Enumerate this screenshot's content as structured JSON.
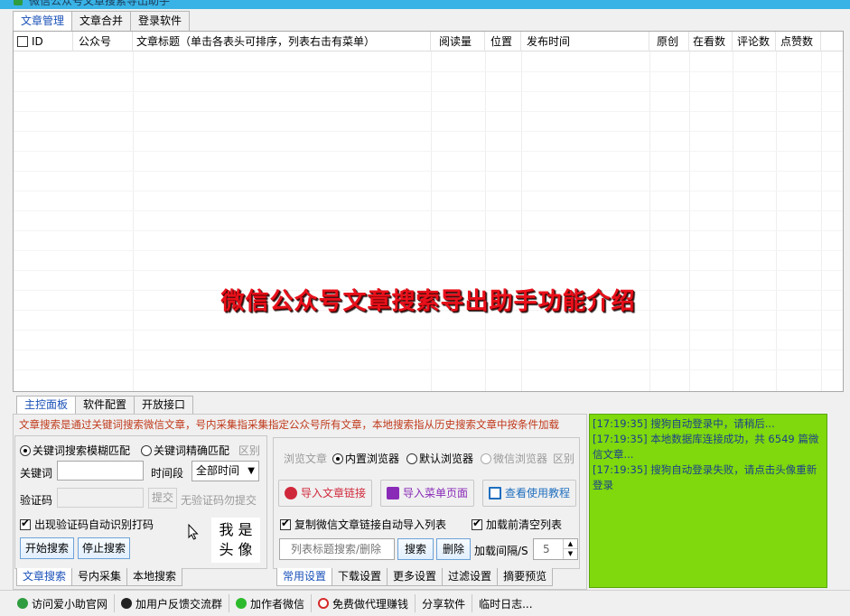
{
  "window": {
    "title": "微信公众号文章搜索导出助手"
  },
  "top_tabs": [
    "文章管理",
    "文章合并",
    "登录软件"
  ],
  "grid": {
    "columns": [
      "ID",
      "公众号",
      "文章标题（单击各表头可排序，列表右击有菜单）",
      "阅读量",
      "位置",
      "发布时间",
      "原创",
      "在看数",
      "评论数",
      "点赞数"
    ],
    "banner": "微信公众号文章搜索导出助手功能介绍"
  },
  "mid_tabs": [
    "主控面板",
    "软件配置",
    "开放接口"
  ],
  "notice": "文章搜索是通过关键词搜索微信文章，号内采集指采集指定公众号所有文章，本地搜索指从历史搜索文章中按条件加载",
  "search_panel": {
    "fuzzy_label": "关键词搜索模糊匹配",
    "exact_label": "关键词精确匹配",
    "distinguish_label": "区别",
    "keyword_label": "关键词",
    "keyword_value": "",
    "time_label": "时间段",
    "time_value": "全部时间",
    "captcha_label": "验证码",
    "captcha_value": "",
    "submit_label": "提交",
    "no_captcha_label": "无验证码勿提交",
    "auto_captcha_label": "出现验证码自动识别打码",
    "start_label": "开始搜索",
    "stop_label": "停止搜索",
    "avatar_line1": "我 是",
    "avatar_line2": "头 像"
  },
  "left_bottom_tabs": [
    "文章搜索",
    "号内采集",
    "本地搜索"
  ],
  "browse_panel": {
    "browse_label": "浏览文章",
    "builtin_label": "内置浏览器",
    "default_label": "默认浏览器",
    "wechat_label": "微信浏览器",
    "distinguish_label": "区别",
    "import_link_label": "导入文章链接",
    "import_menu_label": "导入菜单页面",
    "tutorial_label": "查看使用教程",
    "copy_link_label": "复制微信文章链接自动导入列表",
    "clear_before_label": "加载前清空列表",
    "filter_placeholder": "列表标题搜索/删除",
    "search_label": "搜索",
    "delete_label": "删除",
    "interval_label": "加载间隔/S",
    "interval_value": "5"
  },
  "right_bottom_tabs": [
    "常用设置",
    "下载设置",
    "更多设置",
    "过滤设置",
    "摘要预览"
  ],
  "log_lines": [
    "[17:19:35] 搜狗自动登录中，请稍后...",
    "[17:19:35] 本地数据库连接成功，共 6549 篇微信文章...",
    "[17:19:35] 搜狗自动登录失败，请点击头像重新登录"
  ],
  "statusbar": [
    "访问爱小助官网",
    "加用户反馈交流群",
    "加作者微信",
    "免费做代理赚钱",
    "分享软件",
    "临时日志..."
  ],
  "colors": {
    "accent": "#1a51b8",
    "banner": "#e8101a",
    "log_bg": "#7fd90c",
    "notice": "#c0391b"
  }
}
